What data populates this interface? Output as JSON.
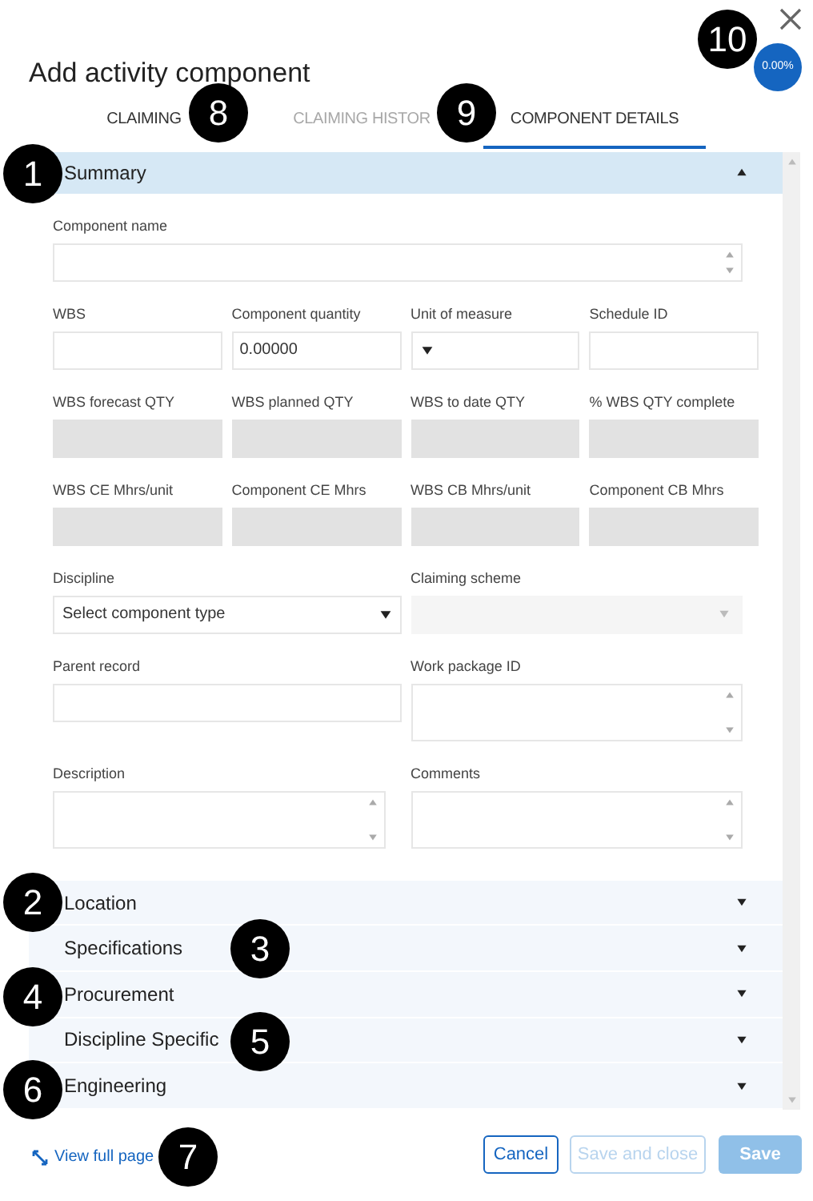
{
  "dialog": {
    "title": "Add activity component",
    "progress": "0.00%"
  },
  "tabs": [
    {
      "label": "CLAIMING",
      "selected": false,
      "disabled": false
    },
    {
      "label": "CLAIMING HISTOR",
      "selected": false,
      "disabled": true
    },
    {
      "label": "COMPONENT DETAILS",
      "selected": true,
      "disabled": false
    }
  ],
  "sections": [
    {
      "title": "Summary",
      "expanded": true,
      "rows": [
        [
          {
            "label": "Component name",
            "kind": "textarea"
          }
        ],
        [
          {
            "label": "WBS",
            "kind": "text"
          },
          {
            "label": "Component quantity",
            "kind": "text",
            "value": "0.00000"
          },
          {
            "label": "Unit of measure",
            "kind": "select"
          },
          {
            "label": "Schedule ID",
            "kind": "text"
          }
        ],
        [
          {
            "label": "WBS forecast QTY",
            "kind": "readonly"
          },
          {
            "label": "WBS planned QTY",
            "kind": "readonly"
          },
          {
            "label": "WBS to date QTY",
            "kind": "readonly"
          },
          {
            "label": "% WBS QTY complete",
            "kind": "readonly"
          }
        ],
        [
          {
            "label": "WBS CE Mhrs/unit",
            "kind": "readonly"
          },
          {
            "label": "Component CE Mhrs",
            "kind": "readonly"
          },
          {
            "label": "WBS CB Mhrs/unit",
            "kind": "readonly"
          },
          {
            "label": "Component CB Mhrs",
            "kind": "readonly"
          }
        ],
        [
          {
            "label": "Discipline",
            "kind": "select",
            "value": "Select component type"
          },
          {
            "label": "Claiming scheme",
            "kind": "disabled-select"
          }
        ],
        [
          {
            "label": "Parent record",
            "kind": "text"
          },
          {
            "label": "Work package ID",
            "kind": "textarea"
          }
        ],
        [
          {
            "label": "Description",
            "kind": "textarea"
          },
          {
            "label": "Comments",
            "kind": "textarea"
          }
        ]
      ]
    },
    {
      "title": "Location",
      "expanded": false
    },
    {
      "title": "Specifications",
      "expanded": false
    },
    {
      "title": "Procurement",
      "expanded": false
    },
    {
      "title": "Discipline Specific",
      "expanded": false
    },
    {
      "title": "Engineering",
      "expanded": false
    }
  ],
  "footer": {
    "link": "View full page",
    "buttons": [
      {
        "label": "Cancel",
        "kind": "outline",
        "disabled": false
      },
      {
        "label": "Save and close",
        "kind": "outline",
        "disabled": true
      },
      {
        "label": "Save",
        "kind": "primary",
        "disabled": true
      }
    ]
  },
  "callouts": [
    "1",
    "2",
    "3",
    "4",
    "5",
    "6",
    "7",
    "8",
    "9",
    "10"
  ]
}
